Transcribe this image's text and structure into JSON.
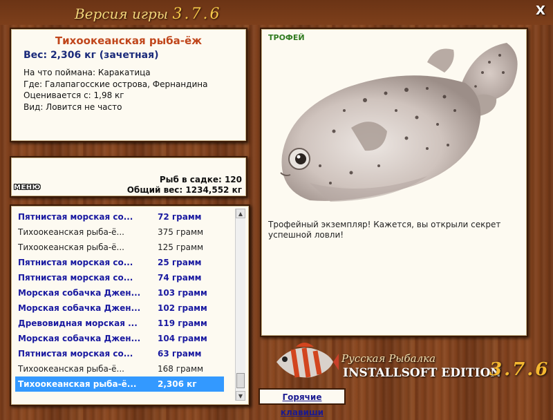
{
  "window": {
    "title_prefix": "Версия игры",
    "title_version": "3.7.6",
    "close_label": "X"
  },
  "info": {
    "fish_name": "Тихоокеанская рыба-ёж",
    "weight": "Вес: 2,306 кг (зачетная)",
    "lines": [
      "На что поймана: Каракатица",
      "Где: Галапагосские острова, Фернандина",
      "Оценивается с: 1,98 кг",
      "Вид: Ловится не часто"
    ]
  },
  "stats": {
    "menu_label": "МЕНЮ",
    "fish_in_keepnet": "Рыб в садке: 120",
    "total_weight": "Общий вес: 1234,552 кг"
  },
  "catch_list": [
    {
      "name": "Пятнистая морская со...",
      "weight": "72 грамм",
      "style": "hi"
    },
    {
      "name": "Тихоокеанская рыба-ё...",
      "weight": "375 грамм",
      "style": "norm"
    },
    {
      "name": "Тихоокеанская рыба-ё...",
      "weight": "125 грамм",
      "style": "norm"
    },
    {
      "name": "Пятнистая морская со...",
      "weight": "25 грамм",
      "style": "hi"
    },
    {
      "name": "Пятнистая морская со...",
      "weight": "74 грамм",
      "style": "hi"
    },
    {
      "name": "Морская собачка Джен...",
      "weight": "103 грамм",
      "style": "hi"
    },
    {
      "name": "Морская собачка Джен...",
      "weight": "102 грамм",
      "style": "hi"
    },
    {
      "name": "Древовидная морская ...",
      "weight": "119 грамм",
      "style": "hi"
    },
    {
      "name": "Морская собачка Джен...",
      "weight": "104 грамм",
      "style": "hi"
    },
    {
      "name": "Пятнистая морская со...",
      "weight": "63 грамм",
      "style": "hi"
    },
    {
      "name": "Тихоокеанская рыба-ё...",
      "weight": "168 грамм",
      "style": "norm"
    },
    {
      "name": "Тихоокеанская рыба-ё...",
      "weight": "2,306 кг",
      "style": "sel"
    }
  ],
  "trophy": {
    "label": "ТРОФЕЙ",
    "text": "Трофейный экземпляр! Кажется, вы открыли секрет успешной ловли!"
  },
  "logo": {
    "title": "Русская Рыбалка",
    "edition": "INSTALLSOFT EDITION",
    "version": "3.7.6"
  },
  "hotkeys_label": "Горячие клавиши",
  "colors": {
    "wood": "#7a3c1a",
    "accent_name": "#c0461b",
    "accent_weight": "#1a2a7a",
    "selection": "#3399ff"
  }
}
